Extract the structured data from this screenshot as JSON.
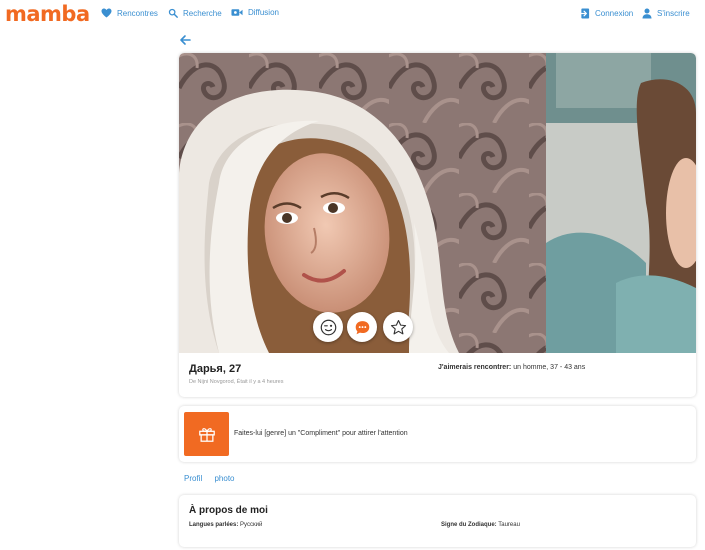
{
  "brand": {
    "logo": "mamba",
    "accent": "#f16a22",
    "link_color": "#3a8fd1"
  },
  "nav": {
    "left": [
      {
        "label": "Rencontres",
        "icon": "heart-icon"
      },
      {
        "label": "Recherche",
        "icon": "search-icon"
      },
      {
        "label": "Diffusion",
        "icon": "video-camera-icon"
      }
    ],
    "right": [
      {
        "label": "Connexion",
        "icon": "login-arrow-icon"
      },
      {
        "label": "S'inscrire",
        "icon": "user-icon"
      }
    ]
  },
  "profile": {
    "name_age": "Дарья, 27",
    "subtitle": "De Nijni Novgorod, Était il y a 4 heures",
    "seeking_label": "J'aimerais rencontrer:",
    "seeking_value": "un homme, 37 - 43 ans",
    "actions": [
      "wink-icon",
      "message-icon",
      "star-icon"
    ]
  },
  "gift": {
    "text": "Faites-lui [genre] un \"Compliment\" pour attirer l'attention",
    "icon": "gift-icon"
  },
  "tabs": [
    "Profil",
    "photo"
  ],
  "about": {
    "title": "À propos de moi",
    "languages_label": "Langues parlées:",
    "languages_value": "Русский",
    "zodiac_label": "Signe du Zodiaque:",
    "zodiac_value": "Taureau"
  }
}
